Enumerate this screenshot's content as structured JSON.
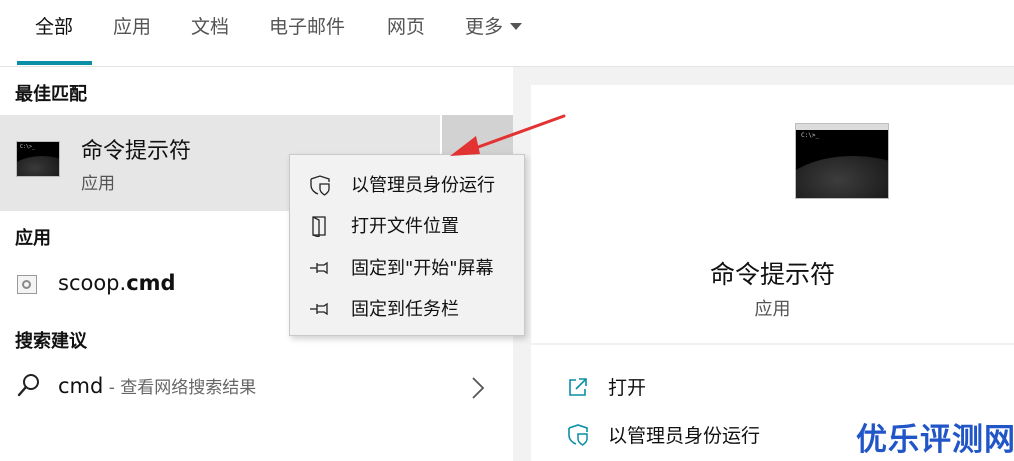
{
  "tabs": [
    {
      "label": "全部",
      "active": true
    },
    {
      "label": "应用"
    },
    {
      "label": "文档"
    },
    {
      "label": "电子邮件"
    },
    {
      "label": "网页"
    },
    {
      "label": "更多"
    }
  ],
  "colors": {
    "accent": "#0a8fa6",
    "annotation_arrow": "#e23232",
    "watermark": "#2156c9"
  },
  "sections": {
    "best_match": "最佳匹配",
    "apps": "应用",
    "search_suggestions": "搜索建议"
  },
  "best_match": {
    "title": "命令提示符",
    "subtitle": "应用",
    "icon": "command-prompt-icon"
  },
  "apps": [
    {
      "name_prefix": "scoop.",
      "name_bold": "cmd",
      "icon": "script-file-icon"
    }
  ],
  "suggestion": {
    "query": "cmd",
    "hint": " - 查看网络搜索结果"
  },
  "context_menu": [
    {
      "label": "以管理员身份运行",
      "icon": "shield-icon"
    },
    {
      "label": "打开文件位置",
      "icon": "file-location-icon"
    },
    {
      "label": "固定到\"开始\"屏幕",
      "icon": "pin-icon"
    },
    {
      "label": "固定到任务栏",
      "icon": "pin-icon"
    }
  ],
  "preview": {
    "title": "命令提示符",
    "subtitle": "应用"
  },
  "actions": [
    {
      "label": "打开",
      "icon": "open-external-icon"
    },
    {
      "label": "以管理员身份运行",
      "icon": "shield-icon"
    }
  ],
  "watermark": "优乐评测网"
}
